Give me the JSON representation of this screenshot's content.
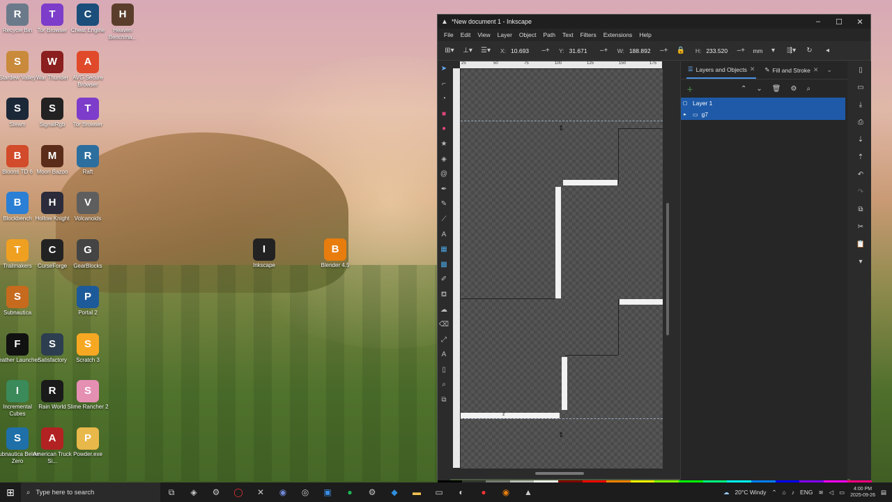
{
  "desktop": {
    "icons": [
      {
        "label": "Recycle Bin",
        "color": "#6b7a8a",
        "icon": "recycle-bin"
      },
      {
        "label": "Tor Browser",
        "color": "#7d3cc9",
        "icon": "tor"
      },
      {
        "label": "Cheat Engine",
        "color": "#1b4e7a",
        "icon": "cheat-engine"
      },
      {
        "label": "Heaven Benchma...",
        "color": "#5a3e2b",
        "icon": "heaven"
      },
      {
        "label": "Stardew Valley",
        "color": "#c98a3b",
        "icon": "stardew"
      },
      {
        "label": "War Thunder",
        "color": "#8b1e1e",
        "icon": "war-thunder"
      },
      {
        "label": "AVG Secure Browser",
        "color": "#e04a2a",
        "icon": "avg"
      },
      {
        "label": "Steam",
        "color": "#1b2838",
        "icon": "steam"
      },
      {
        "label": "SignalRgb",
        "color": "#222",
        "icon": "signalrgb"
      },
      {
        "label": "Tor Browser",
        "color": "#7d3cc9",
        "icon": "tor"
      },
      {
        "label": "Bloons TD 6",
        "color": "#d24b2a",
        "icon": "bloons"
      },
      {
        "label": "Moon Bazoo",
        "color": "#5b2c1a",
        "icon": "moon"
      },
      {
        "label": "Raft",
        "color": "#2c6e9e",
        "icon": "raft"
      },
      {
        "label": "Blockbench",
        "color": "#2b7fd4",
        "icon": "blockbench"
      },
      {
        "label": "Hollow Knight",
        "color": "#2b2b3b",
        "icon": "hollow-knight"
      },
      {
        "label": "Volcanoids",
        "color": "#5e5e5e",
        "icon": "volcanoids"
      },
      {
        "label": "Trailmakers",
        "color": "#f0a020",
        "icon": "trailmakers"
      },
      {
        "label": "CurseForge",
        "color": "#222",
        "icon": "curseforge"
      },
      {
        "label": "GearBlocks",
        "color": "#444",
        "icon": "gearblocks"
      },
      {
        "label": "Subnautica",
        "color": "#c66a1e",
        "icon": "subnautica"
      },
      {
        "label": "Portal 2",
        "color": "#1d5a9a",
        "icon": "portal"
      },
      {
        "label": "Feather Launcher",
        "color": "#111",
        "icon": "feather"
      },
      {
        "label": "Satisfactory",
        "color": "#2d3e50",
        "icon": "satisfactory"
      },
      {
        "label": "Scratch 3",
        "color": "#f7a823",
        "icon": "scratch"
      },
      {
        "label": "Incremental Cubes",
        "color": "#3a8a5a",
        "icon": "cubes"
      },
      {
        "label": "Rain World",
        "color": "#1a1a1a",
        "icon": "rain-world"
      },
      {
        "label": "Slime Rancher 2",
        "color": "#e58fb3",
        "icon": "slime"
      },
      {
        "label": "Subnautica Below Zero",
        "color": "#1f6fa8",
        "icon": "subnautica-bz"
      },
      {
        "label": "American Truck Si...",
        "color": "#b22222",
        "icon": "truck"
      },
      {
        "label": "Powder.exe",
        "color": "#e8b84a",
        "icon": "powder"
      },
      {
        "label": "Inkscape",
        "color": "#222",
        "icon": "inkscape"
      },
      {
        "label": "Blender 4.5",
        "color": "#e87d0d",
        "icon": "blender"
      }
    ]
  },
  "inkscape": {
    "title": "*New document 1 - Inkscape",
    "menu": [
      "File",
      "Edit",
      "View",
      "Layer",
      "Object",
      "Path",
      "Text",
      "Filters",
      "Extensions",
      "Help"
    ],
    "controls": {
      "x_label": "X:",
      "x_value": "10.693",
      "y_label": "Y:",
      "y_value": "31.671",
      "w_label": "W:",
      "w_value": "188.892",
      "h_label": "H:",
      "h_value": "233.520",
      "unit": "mm"
    },
    "ruler_ticks": [
      "25",
      "50",
      "75",
      "100",
      "125",
      "150",
      "175"
    ],
    "canvas_label": "z",
    "dock": {
      "tabs": [
        {
          "label": "Layers and Objects"
        },
        {
          "label": "Fill and Stroke"
        }
      ],
      "layers": [
        {
          "name": "Layer 1"
        },
        {
          "name": "g7"
        }
      ]
    }
  },
  "taskbar": {
    "search_placeholder": "Type here to search",
    "weather": "20°C  Windy",
    "language": "ENG",
    "time": "4:00 PM",
    "date": "2025-09-26"
  }
}
